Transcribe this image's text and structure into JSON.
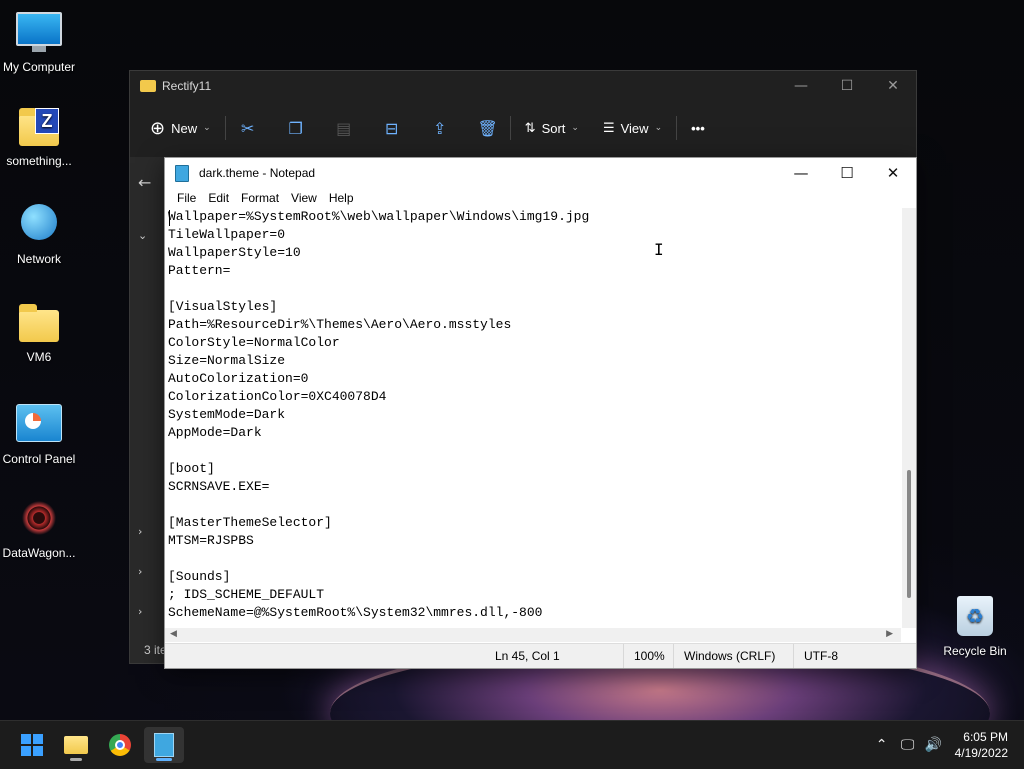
{
  "desktop": {
    "icons": [
      {
        "label": "My Computer",
        "icon": "computer-icon"
      },
      {
        "label": "something...",
        "icon": "zip-folder-icon"
      },
      {
        "label": "Network",
        "icon": "network-icon"
      },
      {
        "label": "VM6",
        "icon": "folder-icon"
      },
      {
        "label": "Control Panel",
        "icon": "control-panel-icon"
      },
      {
        "label": "DataWagon...",
        "icon": "shortcut-icon"
      },
      {
        "label": "Recycle Bin",
        "icon": "recycle-bin-icon"
      }
    ]
  },
  "explorer": {
    "title": "Rectify11",
    "toolbar": {
      "new_label": "New",
      "sort_label": "Sort",
      "view_label": "View",
      "more_label": "•••"
    },
    "status_text": "3 ite"
  },
  "notepad": {
    "title": "dark.theme - Notepad",
    "menu": [
      "File",
      "Edit",
      "Format",
      "View",
      "Help"
    ],
    "content": "Wallpaper=%SystemRoot%\\web\\wallpaper\\Windows\\img19.jpg\nTileWallpaper=0\nWallpaperStyle=10\nPattern=\n\n[VisualStyles]\nPath=%ResourceDir%\\Themes\\Aero\\Aero.msstyles\nColorStyle=NormalColor\nSize=NormalSize\nAutoColorization=0\nColorizationColor=0XC40078D4\nSystemMode=Dark\nAppMode=Dark\n\n[boot]\nSCRNSAVE.EXE=\n\n[MasterThemeSelector]\nMTSM=RJSPBS\n\n[Sounds]\n; IDS_SCHEME_DEFAULT\nSchemeName=@%SystemRoot%\\System32\\mmres.dll,-800",
    "status": {
      "position": "Ln 45, Col 1",
      "zoom": "100%",
      "line_ending": "Windows (CRLF)",
      "encoding": "UTF-8"
    }
  },
  "taskbar": {
    "clock_time": "6:05 PM",
    "clock_date": "4/19/2022"
  }
}
